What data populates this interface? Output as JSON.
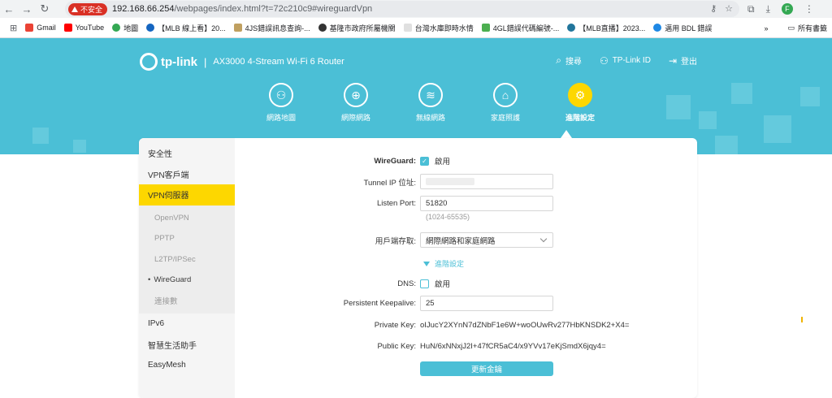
{
  "browser": {
    "security_label": "不安全",
    "url_host": "192.168.66.254",
    "url_path": "/webpages/index.html?t=72c210c9#wireguardVpn",
    "profile_initial": "F",
    "bookmarks": [
      "Gmail",
      "YouTube",
      "地圖",
      "【MLB 線上看】20...",
      "4JS錯誤訊息查詢-...",
      "基隆市政府所屬機關",
      "台灣水庫即時水情",
      "4GL錯誤代碼編號-...",
      "【MLB直播】2023...",
      "邁用 BDL 錯誤"
    ],
    "bookmarks_overflow": "»",
    "all_bookmarks": "所有書籤"
  },
  "header": {
    "brand": "tp-link",
    "model": "AX3000 4-Stream Wi-Fi 6 Router",
    "links": [
      "搜尋",
      "TP-Link ID",
      "登出"
    ]
  },
  "tabs": [
    {
      "label": "網路地圖",
      "icon": "network-map-icon"
    },
    {
      "label": "網際網路",
      "icon": "globe-icon"
    },
    {
      "label": "無線網路",
      "icon": "wifi-icon"
    },
    {
      "label": "家庭照護",
      "icon": "home-care-icon"
    },
    {
      "label": "進階設定",
      "icon": "advanced-gear-icon",
      "active": true
    }
  ],
  "sidebar": {
    "items": [
      "安全性",
      "VPN客戶端",
      "VPN伺服器"
    ],
    "sub_items": [
      "OpenVPN",
      "PPTP",
      "L2TP/IPSec",
      "WireGuard",
      "連接數"
    ],
    "items_after": [
      "IPv6",
      "智慧生活助手",
      "EasyMesh"
    ]
  },
  "form": {
    "wireguard_label": "WireGuard:",
    "enable_label": "啟用",
    "wireguard_enabled": true,
    "tunnel_ip_label": "Tunnel IP 位址:",
    "listen_port_label": "Listen Port:",
    "listen_port_value": "51820",
    "listen_port_hint": "(1024-65535)",
    "client_access_label": "用戶端存取:",
    "client_access_value": "網際網路和家庭網路",
    "advanced_label": "進階設定",
    "dns_label": "DNS:",
    "dns_enabled": false,
    "keepalive_label": "Persistent Keepalive:",
    "keepalive_value": "25",
    "private_key_label": "Private Key:",
    "private_key_value": "oIJucY2XYnN7dZNbF1e6W+woOUwRv277HbKNSDK2+X4=",
    "public_key_label": "Public Key:",
    "public_key_value": "HuN/6xNNxjJ2I+47fCR5aC4/x9YVv17eKjSmdX6jqy4=",
    "renew_button": "更新金鑰"
  },
  "colors": {
    "accent": "#4bbfd6",
    "active": "#fdd700",
    "insecure": "#d93025"
  }
}
